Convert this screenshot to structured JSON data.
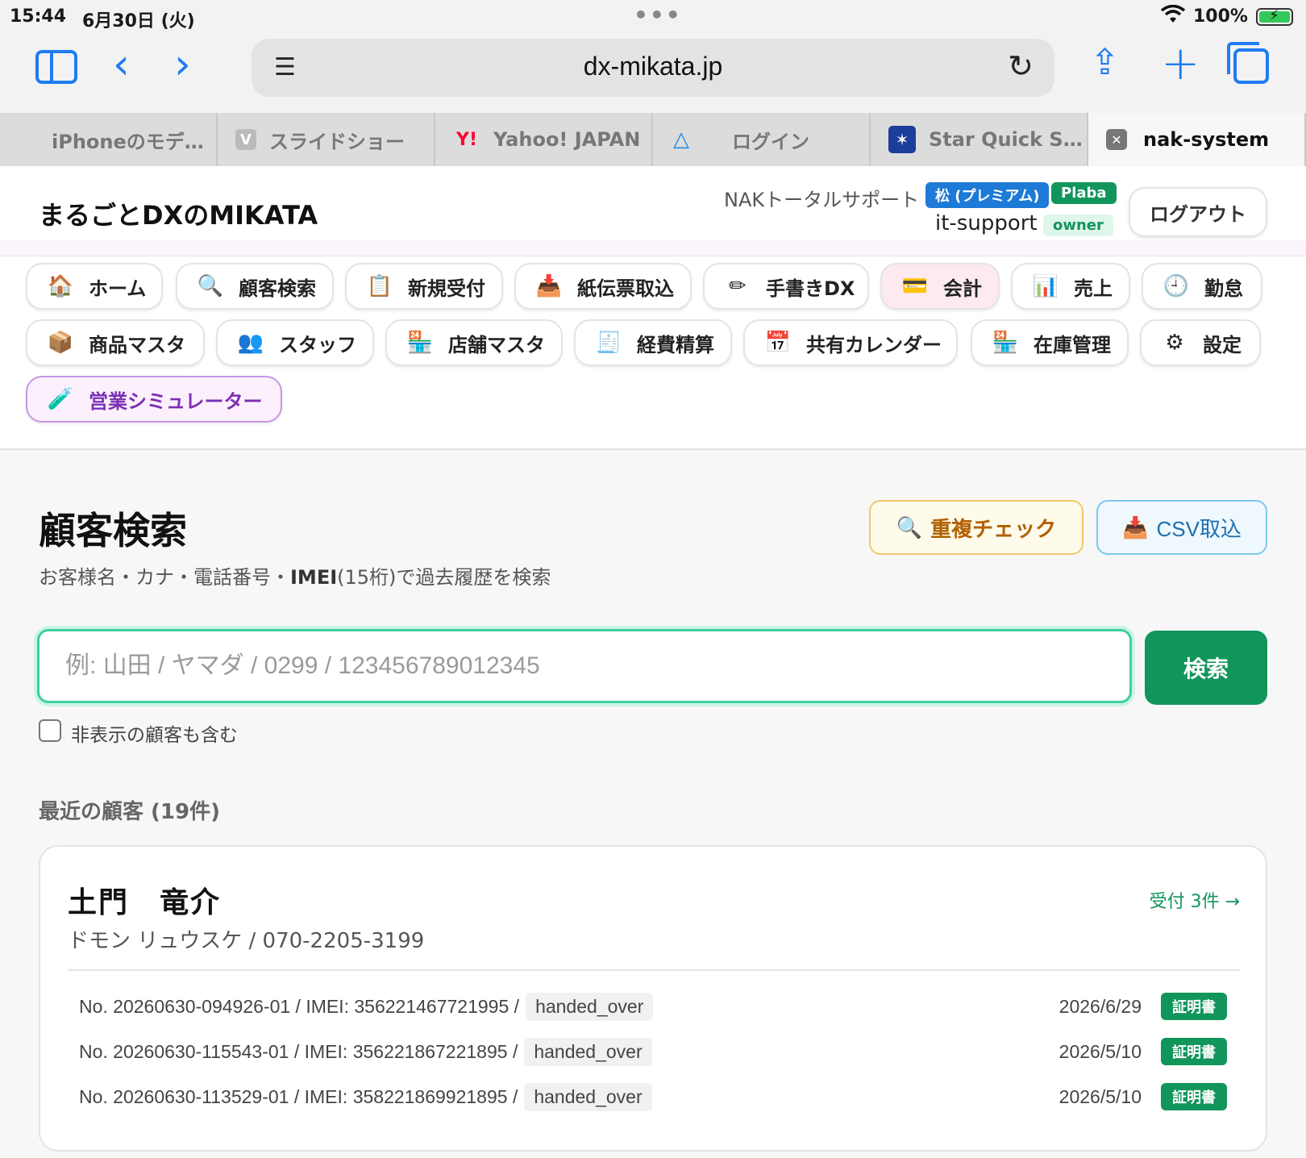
{
  "status_bar": {
    "time": "15:44",
    "date": "6月30日 (火)",
    "battery": "100%"
  },
  "browser": {
    "url": "dx-mikata.jp",
    "tabs": [
      {
        "label": "iPhoneのモデ…",
        "icon": "apple-icon"
      },
      {
        "label": "スライドショー",
        "icon": "v-icon"
      },
      {
        "label": "Yahoo! JAPAN",
        "icon": "yahoo-icon"
      },
      {
        "label": "ログイン",
        "icon": "drive-icon"
      },
      {
        "label": "Star Quick S…",
        "icon": "star-quick-icon"
      },
      {
        "label": "nak-system",
        "icon": "close-icon",
        "active": true
      }
    ]
  },
  "header": {
    "brand": "まるごとDXのMIKATA",
    "org": "NAKトータルサポート",
    "plan_badge": "松 (プレミアム)",
    "brand_badge": "Plaba",
    "username": "it-support",
    "role": "owner",
    "logout": "ログアウト"
  },
  "nav": [
    {
      "label": "ホーム",
      "icon": "🏠"
    },
    {
      "label": "顧客検索",
      "icon": "🔍",
      "active": true
    },
    {
      "label": "新規受付",
      "icon": "📋"
    },
    {
      "label": "紙伝票取込",
      "icon": "📥"
    },
    {
      "label": "手書きDX",
      "icon": "✏"
    },
    {
      "label": "会計",
      "icon": "💳"
    },
    {
      "label": "売上",
      "icon": "📊"
    },
    {
      "label": "勤怠",
      "icon": "🕘"
    },
    {
      "label": "商品マスタ",
      "icon": "📦"
    },
    {
      "label": "スタッフ",
      "icon": "👥"
    },
    {
      "label": "店舗マスタ",
      "icon": "🏪"
    },
    {
      "label": "経費精算",
      "icon": "🧾"
    },
    {
      "label": "共有カレンダー",
      "icon": "📅"
    },
    {
      "label": "在庫管理",
      "icon": "🏪"
    },
    {
      "label": "設定",
      "icon": "⚙"
    },
    {
      "label": "営業シミュレーター",
      "icon": "🧪"
    }
  ],
  "main": {
    "title": "顧客検索",
    "subtitle_pre": "お客様名・カナ・電話番号・",
    "subtitle_bold": "IMEI",
    "subtitle_post": "(15桁)で過去履歴を検索",
    "dup_check": "重複チェック",
    "csv_import": "CSV取込",
    "search_placeholder": "例: 山田 / ヤマダ / 0299 / 123456789012345",
    "search_button": "検索",
    "include_hidden": "非表示の顧客も含む",
    "recent_title": "最近の顧客 (19件)"
  },
  "customer": {
    "name": "土門　竜介",
    "kana_phone": "ドモン リュウスケ / 070-2205-3199",
    "count": "受付 3件 →",
    "records": [
      {
        "text": "No. 20260630-094926-01 / IMEI: 356221467721995 /",
        "status": "handed_over",
        "date": "2026/6/29",
        "cert": "証明書"
      },
      {
        "text": "No. 20260630-115543-01 / IMEI: 356221867221895 /",
        "status": "handed_over",
        "date": "2026/5/10",
        "cert": "証明書"
      },
      {
        "text": "No. 20260630-113529-01 / IMEI: 358221869921895 /",
        "status": "handed_over",
        "date": "2026/5/10",
        "cert": "証明書"
      }
    ]
  }
}
